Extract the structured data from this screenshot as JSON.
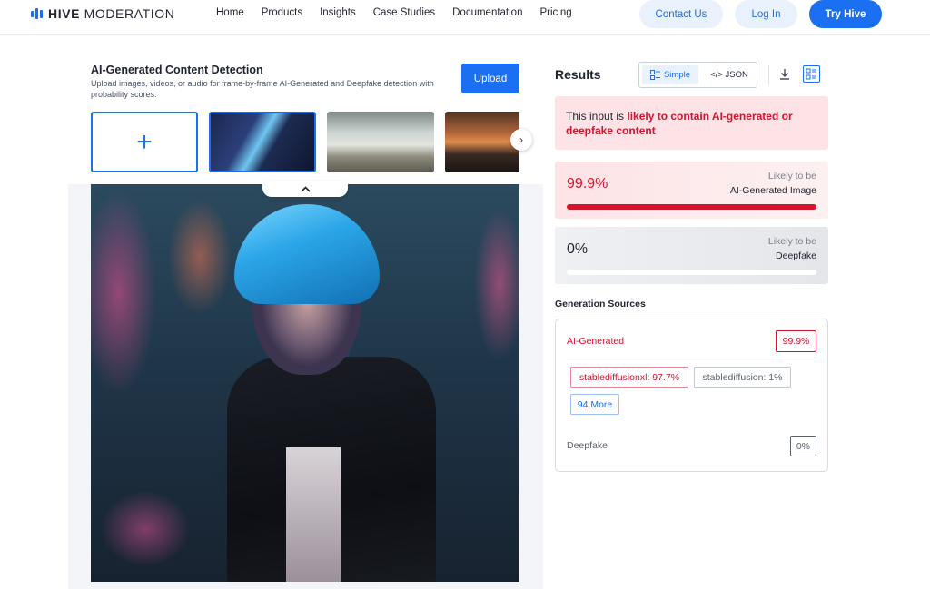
{
  "nav": {
    "brand_bold": "HIVE",
    "brand_rest": "MODERATION",
    "links": [
      "Home",
      "Products",
      "Insights",
      "Case Studies",
      "Documentation",
      "Pricing"
    ],
    "contact": "Contact Us",
    "login": "Log In",
    "try": "Try Hive"
  },
  "detection": {
    "title": "AI-Generated Content Detection",
    "description": "Upload images, videos, or audio for frame-by-frame AI-Generated and Deepfake detection with probability scores.",
    "upload": "Upload",
    "add_glyph": "+",
    "next_glyph": "›",
    "collapse_glyph": "^"
  },
  "results": {
    "title": "Results",
    "simple": "Simple",
    "json": "</> JSON",
    "alert_prefix": "This input is ",
    "alert_emphasis": "likely to contain AI-generated or deepfake content",
    "ai_card": {
      "value": "99.9%",
      "label1": "Likely to be",
      "label2": "AI-Generated Image",
      "fill": 0.999
    },
    "df_card": {
      "value": "0%",
      "label1": "Likely to be",
      "label2": "Deepfake",
      "fill": 0
    },
    "colors": {
      "accent": "#1a6ff3",
      "danger": "#d4142d"
    }
  },
  "generation": {
    "title": "Generation Sources",
    "ai_label": "AI-Generated",
    "ai_score": "99.9%",
    "sources": [
      "stablediffusionxl: 97.7%",
      "stablediffusion: 1%"
    ],
    "more": "94 More",
    "deepfake_label": "Deepfake",
    "deepfake_score": "0%"
  }
}
